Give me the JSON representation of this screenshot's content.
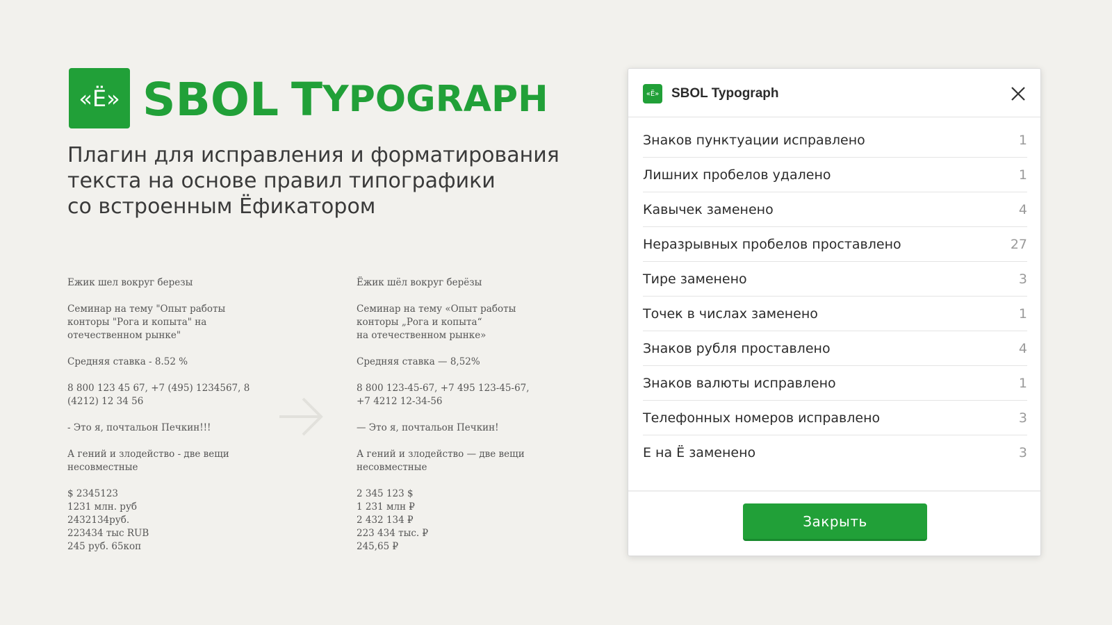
{
  "brand": {
    "logo_glyph": "«Ё»",
    "title_first": "SBOL",
    "title_second_initial": "T",
    "title_second_rest": "YPOGRAPH",
    "color": "#21a038"
  },
  "tagline": [
    "Плагин для исправления и форматирования",
    "текста на основе правил типографики",
    "со встроенным Ёфикатором"
  ],
  "samples": {
    "before": [
      [
        "Ежик шел вокруг березы"
      ],
      [
        "Семинар на тему \"Опыт работы",
        "конторы \"Рога и копыта\" на",
        "отечественном рынке\""
      ],
      [
        "Средняя ставка - 8.52 %"
      ],
      [
        "8 800 123 45 67, +7 (495) 1234567, 8",
        "(4212) 12 34 56"
      ],
      [
        "- Это я, почтальон Печкин!!!"
      ],
      [
        "А гений и злодейство - две вещи",
        "несовместные"
      ],
      [
        "$ 2345123",
        "1231 млн. руб",
        "2432134руб.",
        "223434 тыс RUB",
        "245 руб. 65коп"
      ]
    ],
    "after": [
      [
        "Ёжик шёл вокруг берёзы"
      ],
      [
        "Семинар на тему «Опыт работы",
        "конторы „Рога и копыта“",
        "на отечественном рынке»"
      ],
      [
        "Средняя ставка — 8,52%"
      ],
      [
        "8 800 123-45-67, +7 495 123-45-67,",
        "+7 4212 12-34-56"
      ],
      [
        "— Это я, почтальон Печкин!"
      ],
      [
        "А гений и злодейство — две вещи",
        "несовместные"
      ],
      [
        "2 345 123 $",
        "1 231 млн ₽",
        "2 432 134 ₽",
        "223 434 тыс. ₽",
        "245,65 ₽"
      ]
    ],
    "arrow_icon": "arrow-right-icon"
  },
  "dialog": {
    "icon_glyph": "«Ё»",
    "title": "SBOL Typograph",
    "close_icon": "close-icon",
    "stats": [
      {
        "label": "Знаков пунктуации исправлено",
        "value": "1"
      },
      {
        "label": "Лишних пробелов удалено",
        "value": "1"
      },
      {
        "label": "Кавычек заменено",
        "value": "4"
      },
      {
        "label": "Неразрывных пробелов проставлено",
        "value": "27"
      },
      {
        "label": "Тире заменено",
        "value": "3"
      },
      {
        "label": "Точек в числах заменено",
        "value": "1"
      },
      {
        "label": "Знаков рубля проставлено",
        "value": "4"
      },
      {
        "label": "Знаков валюты исправлено",
        "value": "1"
      },
      {
        "label": "Телефонных номеров исправлено",
        "value": "3"
      },
      {
        "label": "Е на Ё заменено",
        "value": "3"
      }
    ],
    "close_button_label": "Закрыть"
  }
}
